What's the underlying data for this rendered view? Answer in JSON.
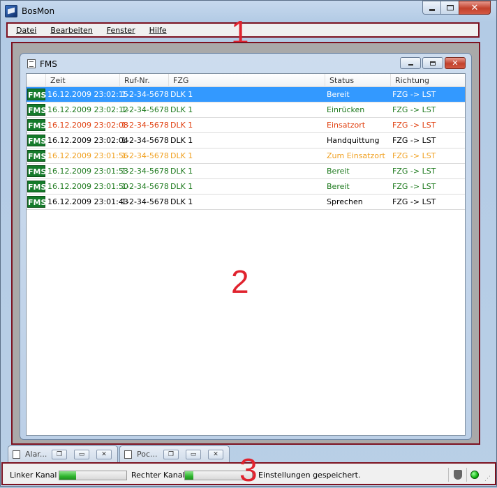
{
  "app": {
    "title": "BosMon"
  },
  "menu": [
    "Datei",
    "Bearbeiten",
    "Fenster",
    "Hilfe"
  ],
  "annotations": [
    "1",
    "2",
    "3"
  ],
  "child_window": {
    "title": "FMS",
    "columns": [
      "Zeit",
      "Ruf-Nr.",
      "FZG",
      "Status",
      "Richtung"
    ],
    "rows": [
      {
        "badge": "FMS",
        "zeit": "16.12.2009 23:02:15",
        "ruf": "1-2-34-5678",
        "fzg": "DLK 1",
        "status": "Bereit",
        "richtung": "FZG -> LST",
        "color": "#ffffff",
        "selected": true
      },
      {
        "badge": "FMS",
        "zeit": "16.12.2009 23:02:12",
        "ruf": "1-2-34-5678",
        "fzg": "DLK 1",
        "status": "Einrücken",
        "richtung": "FZG -> LST",
        "color": "#1e7a1e",
        "selected": false
      },
      {
        "badge": "FMS",
        "zeit": "16.12.2009 23:02:08",
        "ruf": "1-2-34-5678",
        "fzg": "DLK 1",
        "status": "Einsatzort",
        "richtung": "FZG -> LST",
        "color": "#e04010",
        "selected": false
      },
      {
        "badge": "FMS",
        "zeit": "16.12.2009 23:02:04",
        "ruf": "1-2-34-5678",
        "fzg": "DLK 1",
        "status": "Handquittung",
        "richtung": "FZG -> LST",
        "color": "#000000",
        "selected": false
      },
      {
        "badge": "FMS",
        "zeit": "16.12.2009 23:01:56",
        "ruf": "1-2-34-5678",
        "fzg": "DLK 1",
        "status": "Zum Einsatzort",
        "richtung": "FZG -> LST",
        "color": "#f0a020",
        "selected": false
      },
      {
        "badge": "FMS",
        "zeit": "16.12.2009 23:01:53",
        "ruf": "1-2-34-5678",
        "fzg": "DLK 1",
        "status": "Bereit",
        "richtung": "FZG -> LST",
        "color": "#1e7a1e",
        "selected": false
      },
      {
        "badge": "FMS",
        "zeit": "16.12.2009 23:01:50",
        "ruf": "1-2-34-5678",
        "fzg": "DLK 1",
        "status": "Bereit",
        "richtung": "FZG -> LST",
        "color": "#1e7a1e",
        "selected": false
      },
      {
        "badge": "FMS",
        "zeit": "16.12.2009 23:01:43",
        "ruf": "1-2-34-5678",
        "fzg": "DLK 1",
        "status": "Sprechen",
        "richtung": "FZG -> LST",
        "color": "#000000",
        "selected": false
      }
    ]
  },
  "tabs": [
    {
      "label": "Alar..."
    },
    {
      "label": "Poc..."
    }
  ],
  "statusbar": {
    "left_label": "Linker Kanal",
    "left_level": 0.25,
    "right_label": "Rechter Kanal",
    "right_level": 0.12,
    "message": "Einstellungen gespeichert."
  },
  "icons": {
    "status_shield": "shield-icon",
    "status_led": "led-icon",
    "resize": "grip-icon"
  },
  "colors": {
    "selection": "#3399ff",
    "badge": "#147a2a",
    "annotation": "#e0232e",
    "annotation_frame": "#7c1120"
  }
}
